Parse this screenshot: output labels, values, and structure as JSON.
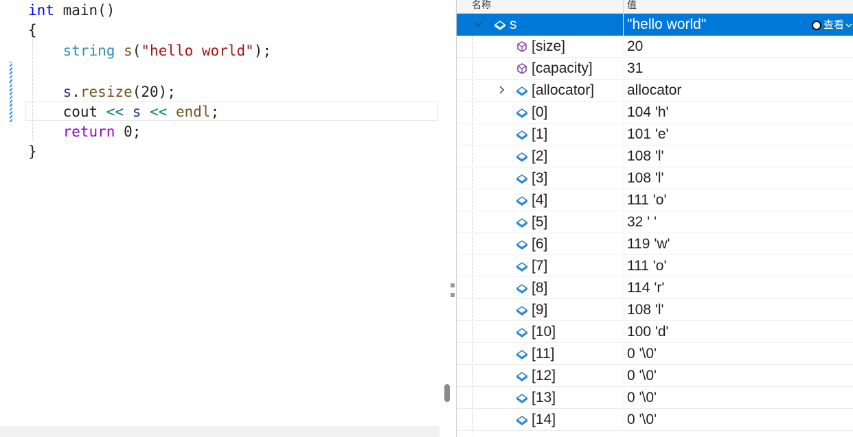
{
  "code": {
    "lines": [
      [
        {
          "t": "int",
          "c": "kw"
        },
        {
          "t": " main()",
          "c": "plain"
        }
      ],
      [
        {
          "t": "{",
          "c": "plain"
        }
      ],
      [
        {
          "t": "    ",
          "c": "plain"
        },
        {
          "t": "string",
          "c": "type"
        },
        {
          "t": " ",
          "c": "plain"
        },
        {
          "t": "s",
          "c": "fn"
        },
        {
          "t": "(",
          "c": "plain"
        },
        {
          "t": "\"hello world\"",
          "c": "str"
        },
        {
          "t": ");",
          "c": "plain"
        }
      ],
      [
        {
          "t": "",
          "c": "plain"
        }
      ],
      [
        {
          "t": "    ",
          "c": "plain"
        },
        {
          "t": "s",
          "c": "ident"
        },
        {
          "t": ".",
          "c": "plain"
        },
        {
          "t": "resize",
          "c": "fn"
        },
        {
          "t": "(20);",
          "c": "plain"
        }
      ],
      [
        {
          "t": "    cout ",
          "c": "plain"
        },
        {
          "t": "<<",
          "c": "op"
        },
        {
          "t": " ",
          "c": "plain"
        },
        {
          "t": "s",
          "c": "ident"
        },
        {
          "t": " ",
          "c": "plain"
        },
        {
          "t": "<<",
          "c": "op"
        },
        {
          "t": " ",
          "c": "plain"
        },
        {
          "t": "endl",
          "c": "fn"
        },
        {
          "t": ";",
          "c": "plain"
        }
      ],
      [
        {
          "t": "    ",
          "c": "plain"
        },
        {
          "t": "return",
          "c": "kw2"
        },
        {
          "t": " 0;",
          "c": "plain"
        }
      ],
      [
        {
          "t": "}",
          "c": "plain"
        }
      ]
    ]
  },
  "watch": {
    "header": {
      "name": "名称",
      "value": "值"
    },
    "view_button": "查看",
    "rows": [
      {
        "name": "s",
        "value": "\"hello world\"",
        "expander": "expanded",
        "icon": "variable-icon",
        "selected": true,
        "indent": 0
      },
      {
        "name": "[size]",
        "value": "20",
        "icon": "property-icon",
        "indent": 1
      },
      {
        "name": "[capacity]",
        "value": "31",
        "icon": "property-icon",
        "indent": 1
      },
      {
        "name": "[allocator]",
        "value": "allocator",
        "expander": "collapsed",
        "icon": "variable-icon",
        "indent": 1
      },
      {
        "name": "[0]",
        "value": "104 'h'",
        "icon": "variable-icon",
        "indent": 1
      },
      {
        "name": "[1]",
        "value": "101 'e'",
        "icon": "variable-icon",
        "indent": 1
      },
      {
        "name": "[2]",
        "value": "108 'l'",
        "icon": "variable-icon",
        "indent": 1
      },
      {
        "name": "[3]",
        "value": "108 'l'",
        "icon": "variable-icon",
        "indent": 1
      },
      {
        "name": "[4]",
        "value": "111 'o'",
        "icon": "variable-icon",
        "indent": 1
      },
      {
        "name": "[5]",
        "value": "32 ' '",
        "icon": "variable-icon",
        "indent": 1
      },
      {
        "name": "[6]",
        "value": "119 'w'",
        "icon": "variable-icon",
        "indent": 1
      },
      {
        "name": "[7]",
        "value": "111 'o'",
        "icon": "variable-icon",
        "indent": 1
      },
      {
        "name": "[8]",
        "value": "114 'r'",
        "icon": "variable-icon",
        "indent": 1
      },
      {
        "name": "[9]",
        "value": "108 'l'",
        "icon": "variable-icon",
        "indent": 1
      },
      {
        "name": "[10]",
        "value": "100 'd'",
        "icon": "variable-icon",
        "indent": 1
      },
      {
        "name": "[11]",
        "value": "0 '\\0'",
        "icon": "variable-icon",
        "indent": 1
      },
      {
        "name": "[12]",
        "value": "0 '\\0'",
        "icon": "variable-icon",
        "indent": 1
      },
      {
        "name": "[13]",
        "value": "0 '\\0'",
        "icon": "variable-icon",
        "indent": 1
      },
      {
        "name": "[14]",
        "value": "0 '\\0'",
        "icon": "variable-icon",
        "indent": 1
      }
    ]
  },
  "colors": {
    "selection": "#0078d7",
    "keyword": "#0000ff",
    "type": "#2b91af",
    "string": "#a31515",
    "control_keyword": "#8f08c4",
    "function": "#74531f",
    "variable_icon": "#1a7fd0",
    "property_icon": "#7b3fa0"
  }
}
